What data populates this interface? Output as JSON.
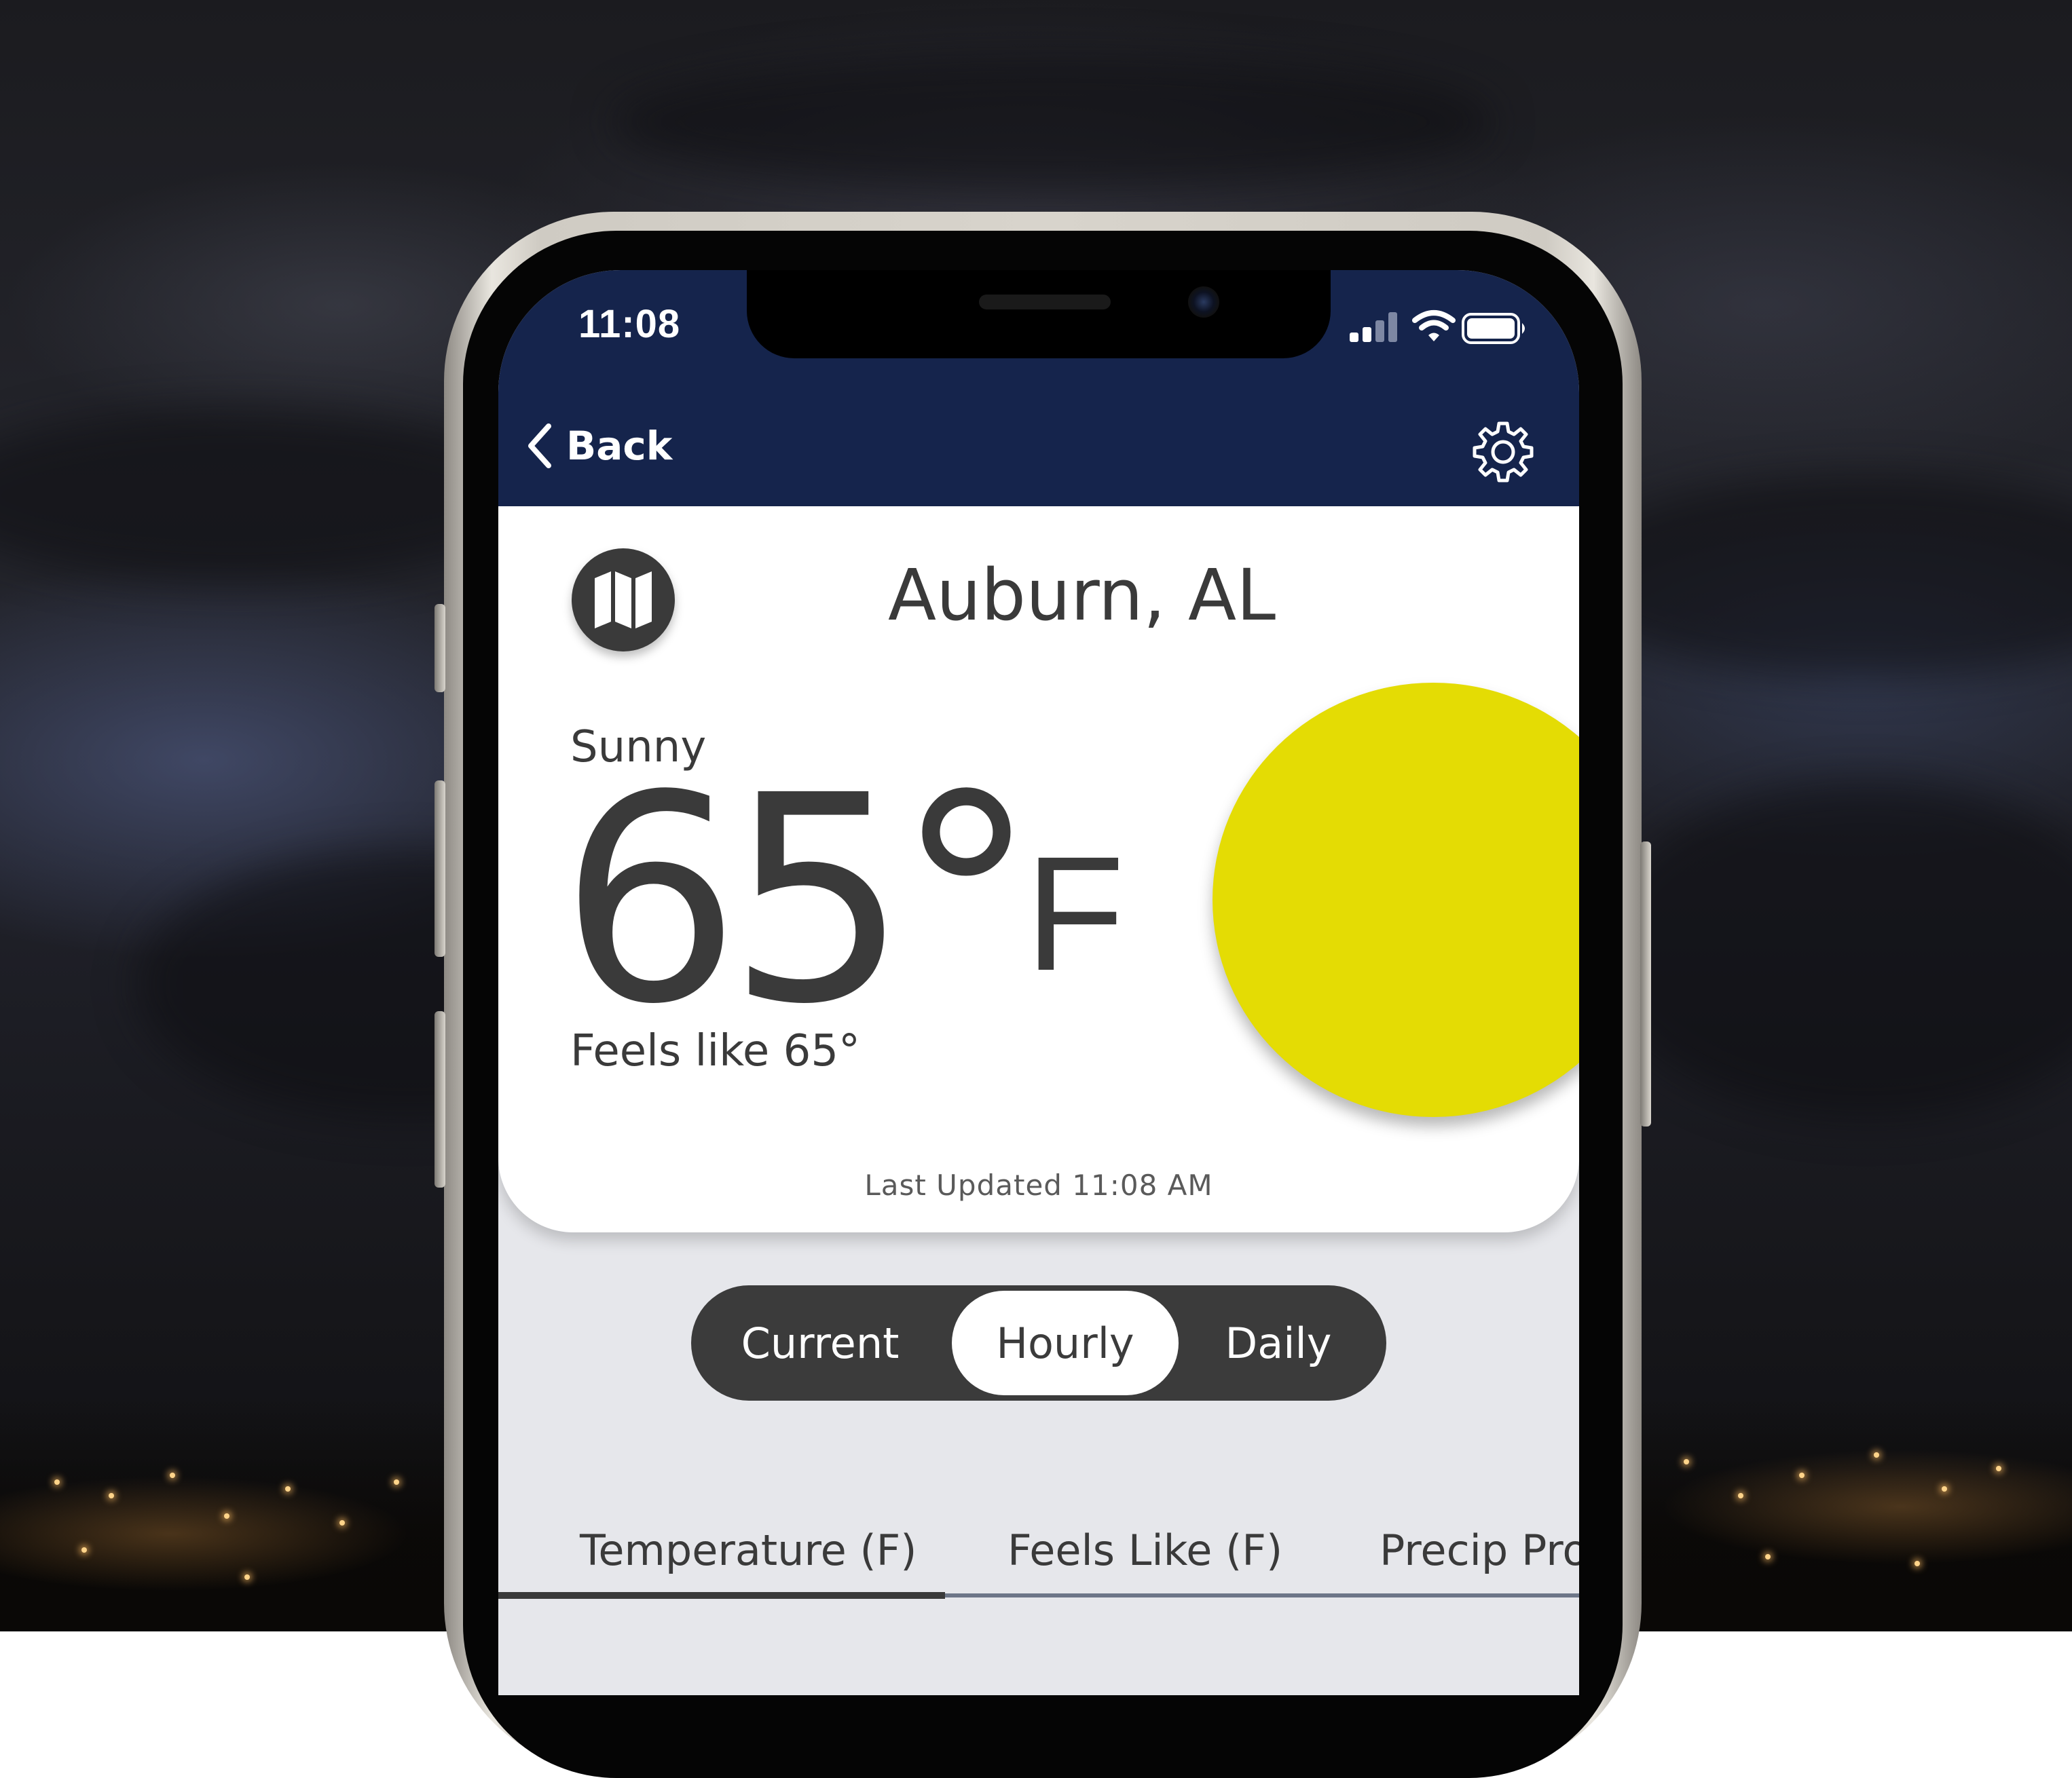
{
  "status_bar": {
    "time": "11:08",
    "icons": [
      "cellular-signal-icon",
      "wifi-icon",
      "battery-icon"
    ]
  },
  "header": {
    "back_label": "Back",
    "settings_icon": "gear-icon",
    "background_color": "#15244c"
  },
  "location": {
    "map_icon": "map-icon",
    "city": "Auburn, AL"
  },
  "current_conditions": {
    "condition": "Sunny",
    "temperature": "65°",
    "unit": "F",
    "feels_like": "Feels like 65°",
    "weather_icon": "sun-icon",
    "sun_color": "#e4dc04",
    "last_updated": "Last Updated 11:08 AM"
  },
  "view_selector": {
    "options": [
      "Current",
      "Hourly",
      "Daily"
    ],
    "selected": "Hourly"
  },
  "metric_tabs": {
    "tabs": [
      "Temperature (F)",
      "Feels Like (F)",
      "Precip Pro"
    ],
    "selected": "Temperature (F)"
  }
}
